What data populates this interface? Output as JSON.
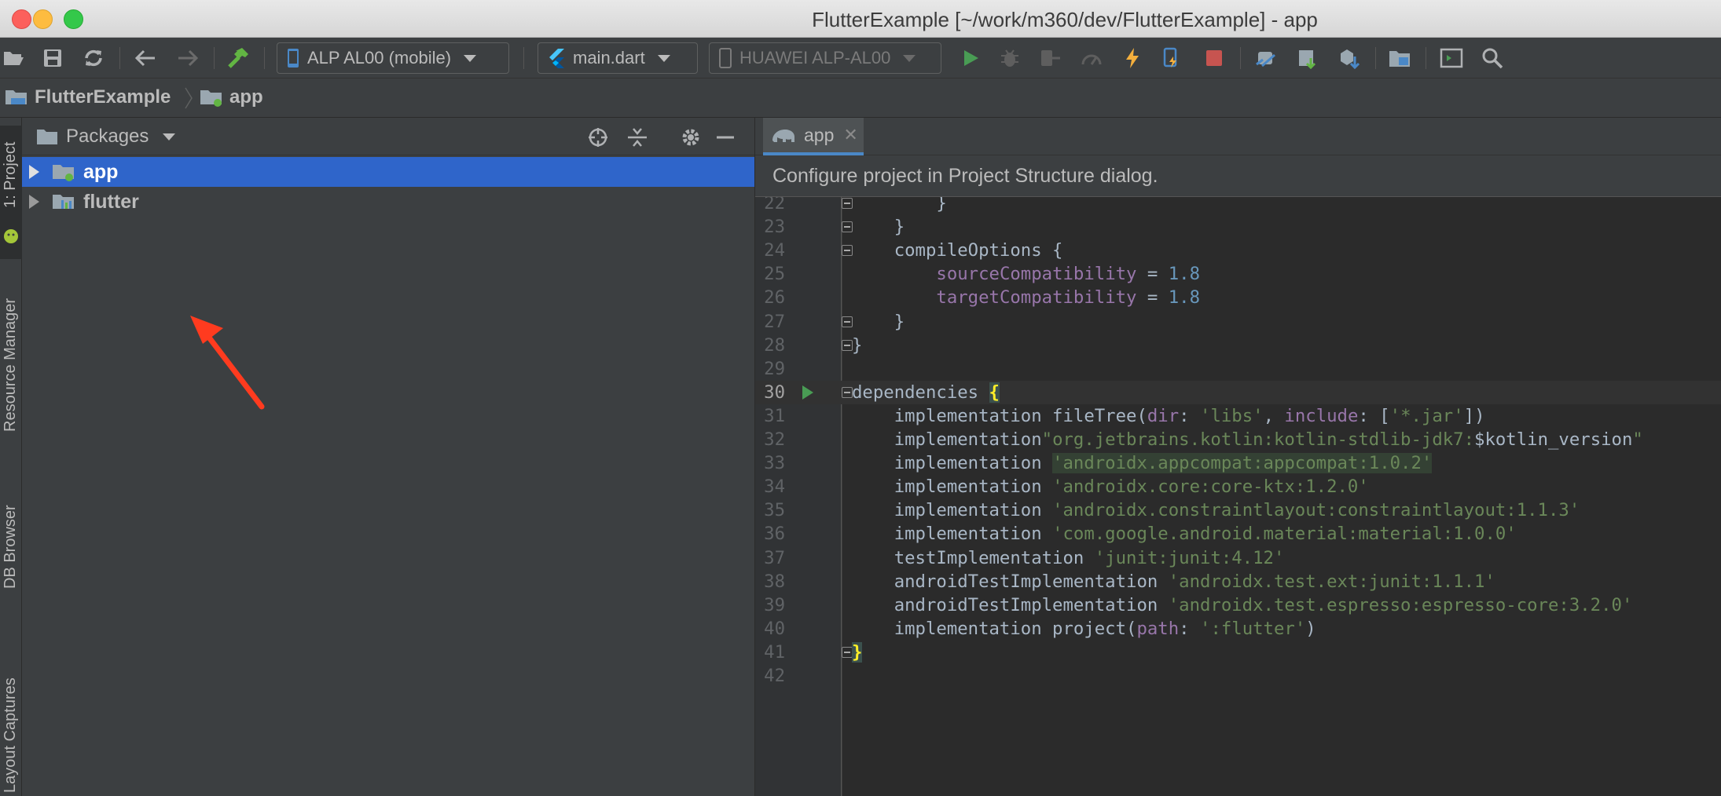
{
  "window": {
    "title": "FlutterExample [~/work/m360/dev/FlutterExample] - app"
  },
  "toolbar": {
    "device_combo": "ALP AL00 (mobile)",
    "run_config_combo": "main.dart",
    "target_combo": "HUAWEI ALP-AL00",
    "icons": [
      "open-icon",
      "save-icon",
      "sync-icon",
      "back-icon",
      "forward-icon",
      "build-hammer-icon",
      "run-icon",
      "debug-icon",
      "attach-icon",
      "profile-icon",
      "hot-reload-icon",
      "hot-restart-icon",
      "stop-icon",
      "avd-icon",
      "sdk-icon",
      "gradle-sync-icon",
      "project-structure-icon",
      "terminal-icon",
      "search-icon"
    ]
  },
  "breadcrumb": {
    "root": "FlutterExample",
    "child": "app"
  },
  "left_stripe": {
    "tabs": [
      "1: Project",
      "Resource Manager",
      "DB Browser",
      "Layout Captures"
    ]
  },
  "project_panel": {
    "view_mode": "Packages",
    "tree": [
      {
        "label": "app",
        "selected": true
      },
      {
        "label": "flutter",
        "selected": false
      }
    ]
  },
  "editor": {
    "tab_label": "app",
    "notice": "Configure project in Project Structure dialog.",
    "current_line": "30",
    "lines": [
      {
        "n": "22",
        "code": "        }"
      },
      {
        "n": "23",
        "code": "    }"
      },
      {
        "n": "24",
        "code": "    compileOptions {"
      },
      {
        "n": "25",
        "key": "sourceCompatibility",
        "eq": " = ",
        "val": "1.8"
      },
      {
        "n": "26",
        "key": "targetCompatibility",
        "eq": " = ",
        "val": "1.8"
      },
      {
        "n": "27",
        "code": "    }"
      },
      {
        "n": "28",
        "code": "}"
      },
      {
        "n": "29",
        "code": ""
      },
      {
        "n": "30",
        "code": "dependencies "
      },
      {
        "n": "31",
        "a": "    implementation fileTree(",
        "p1": "dir",
        "b": ": ",
        "s1": "'libs'",
        "c": ", ",
        "p2": "include",
        "d": ": [",
        "s2": "'*.jar'",
        "e": "])"
      },
      {
        "n": "32",
        "a": "    implementation",
        "s1": "\"org.jetbrains.kotlin:kotlin-stdlib-jdk7:",
        "v": "$kotlin_version",
        "s2": "\""
      },
      {
        "n": "33",
        "a": "    implementation ",
        "s1": "'androidx.appcompat:appcompat:1.0.2'"
      },
      {
        "n": "34",
        "a": "    implementation ",
        "s1": "'androidx.core:core-ktx:1.2.0'"
      },
      {
        "n": "35",
        "a": "    implementation ",
        "s1": "'androidx.constraintlayout:constraintlayout:1.1.3'"
      },
      {
        "n": "36",
        "a": "    implementation ",
        "s1": "'com.google.android.material:material:1.0.0'"
      },
      {
        "n": "37",
        "a": "    testImplementation ",
        "s1": "'junit:junit:4.12'"
      },
      {
        "n": "38",
        "a": "    androidTestImplementation ",
        "s1": "'androidx.test.ext:junit:1.1.1'"
      },
      {
        "n": "39",
        "a": "    androidTestImplementation ",
        "s1": "'androidx.test.espresso:espresso-core:3.2.0'"
      },
      {
        "n": "40",
        "a": "    implementation project(",
        "p1": "path",
        "b": ": ",
        "s1": "':flutter'",
        "e": ")"
      },
      {
        "n": "41",
        "code": ""
      },
      {
        "n": "42",
        "code": ""
      }
    ]
  },
  "colors": {
    "selection": "#2f65ca",
    "annotation_arrow": "#ff3b1f",
    "run_green": "#499c54",
    "stop_red": "#c75450"
  }
}
